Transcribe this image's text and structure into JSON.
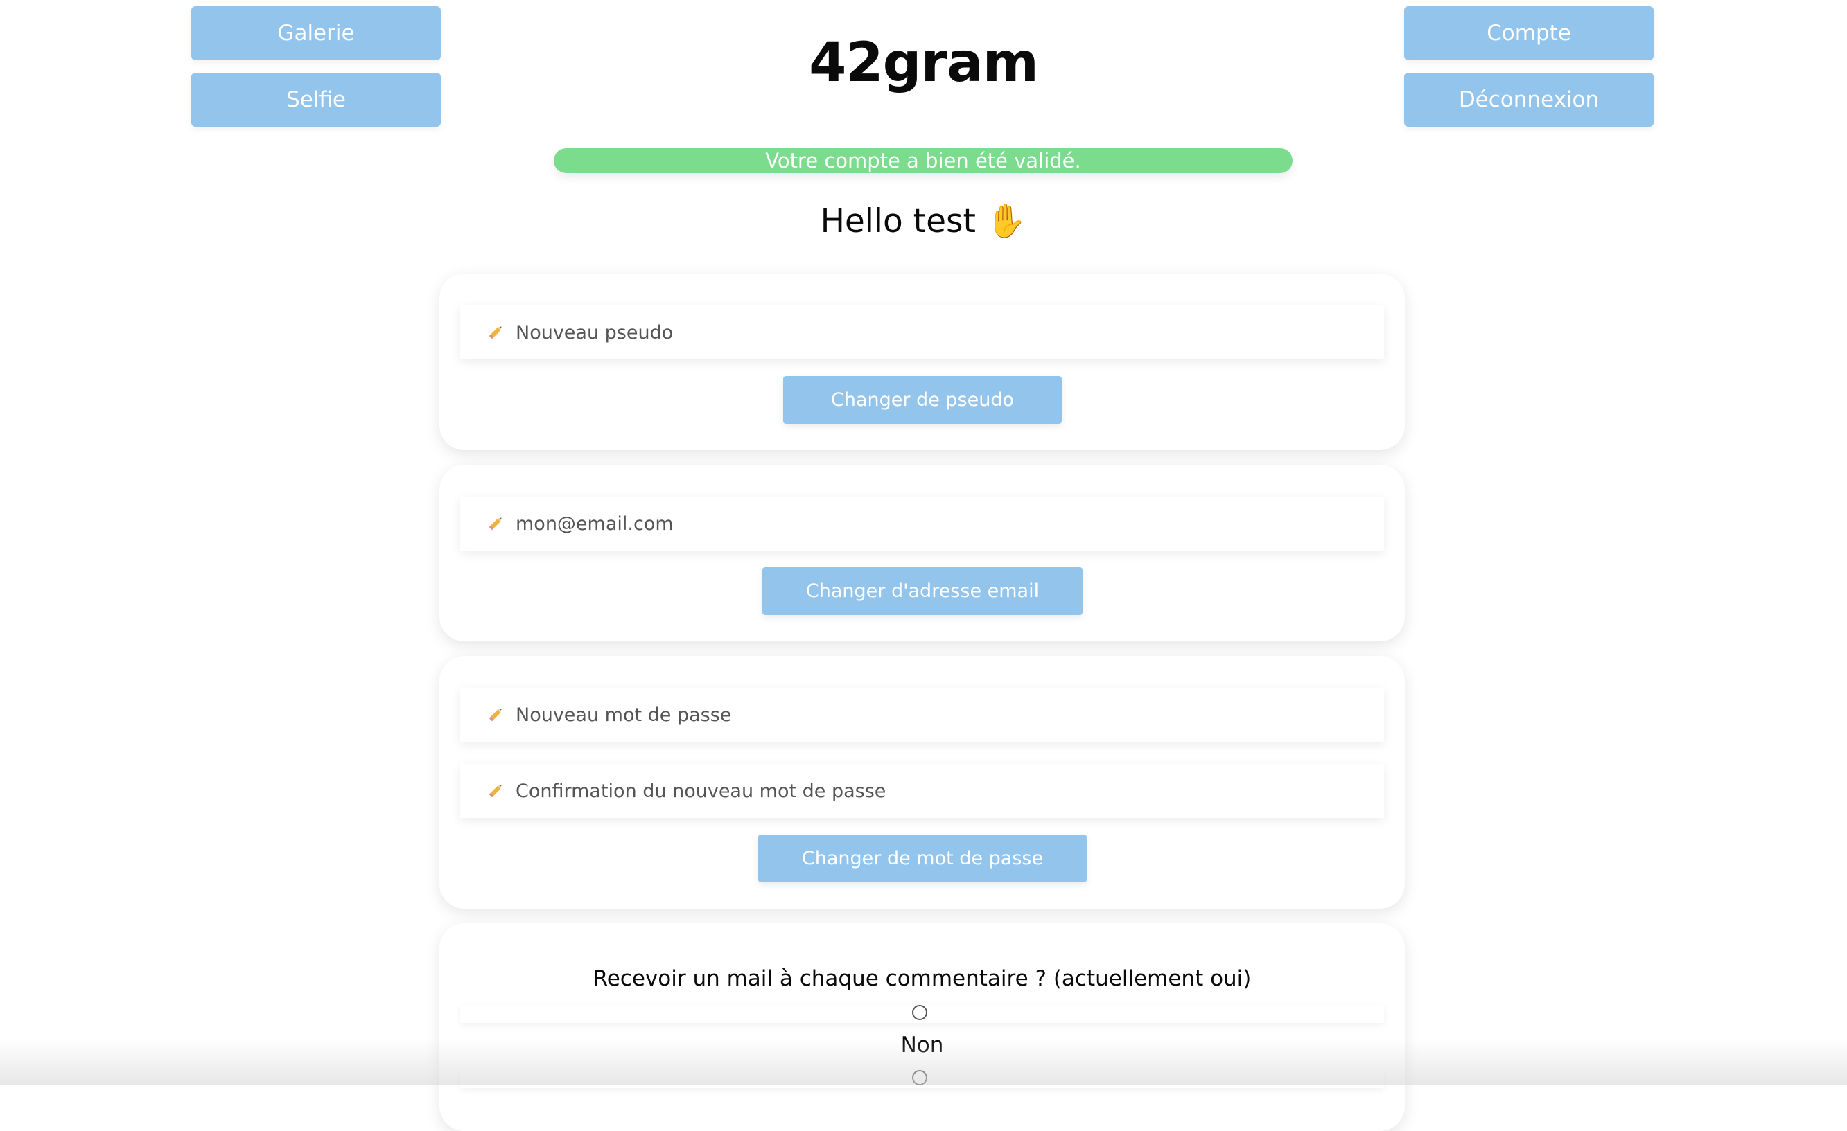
{
  "header": {
    "brand": "42gram",
    "nav_left": [
      "Galerie",
      "Selfie"
    ],
    "nav_right": [
      "Compte",
      "Déconnexion"
    ]
  },
  "alert": {
    "text": "Votre compte a bien été validé.",
    "color": "#7bdc8d"
  },
  "greeting": "Hello test ✋",
  "forms": {
    "pseudo": {
      "placeholder": "Nouveau pseudo",
      "button": "Changer de pseudo"
    },
    "email": {
      "placeholder": "mon@email.com",
      "button": "Changer d'adresse email"
    },
    "password": {
      "placeholder": "Nouveau mot de passe",
      "confirm_placeholder": "Confirmation du nouveau mot de passe",
      "button": "Changer de mot de passe"
    },
    "notifications": {
      "question": "Recevoir un mail à chaque commentaire ? (actuellement oui)",
      "option_no": "Non"
    }
  },
  "icons": {
    "field_icon": "pencil-icon",
    "greeting_icon": "raised-hand-icon"
  },
  "colors": {
    "button": "#93c4ec",
    "alert": "#7bdc8d",
    "background": "#ffffff"
  }
}
